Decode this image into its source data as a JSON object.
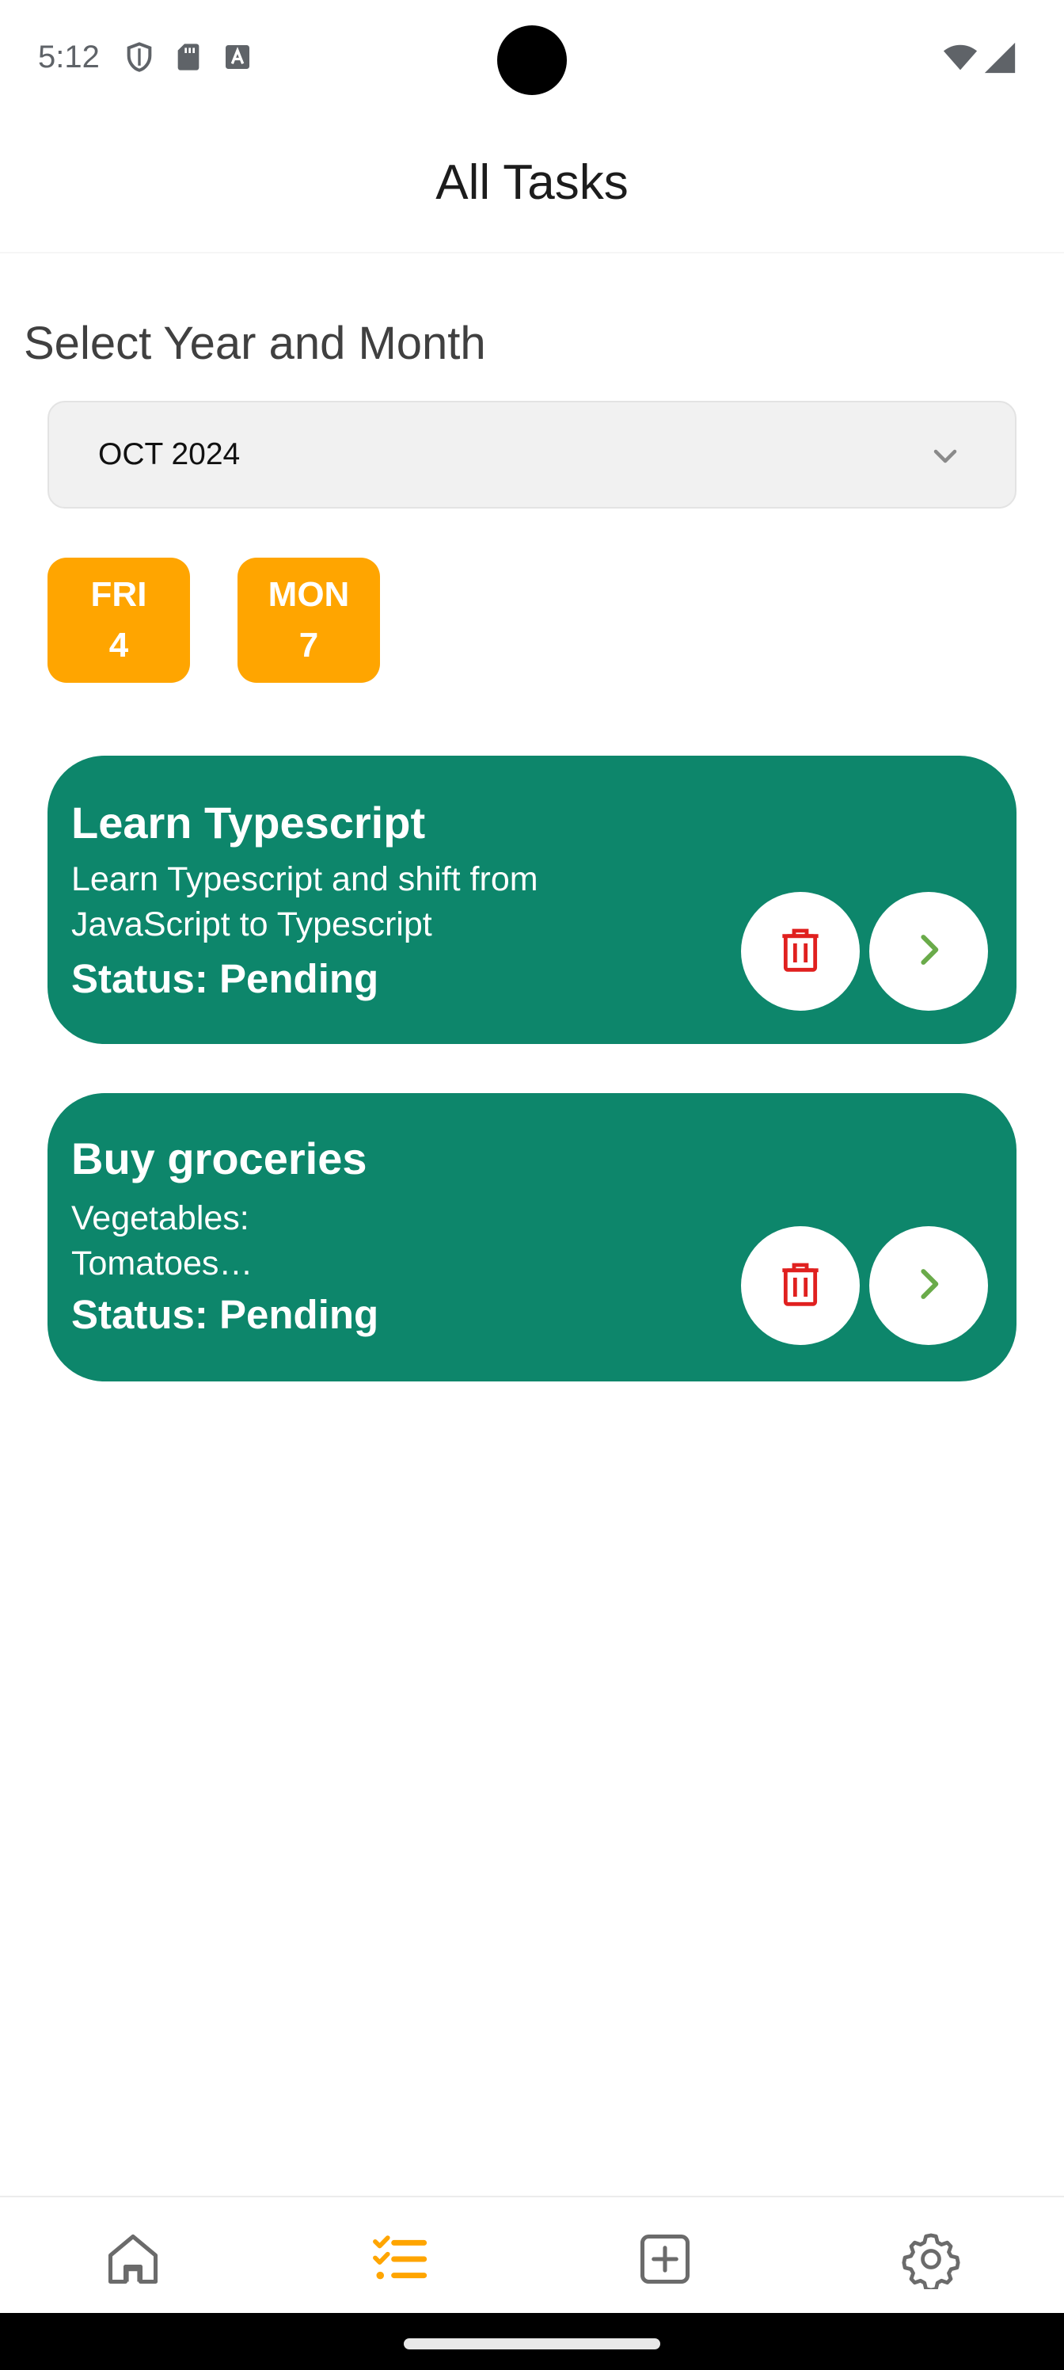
{
  "status_bar": {
    "time": "5:12",
    "left_icons": [
      "shield-icon",
      "sd-card-icon",
      "text-a-icon"
    ],
    "right_icons": [
      "wifi-icon",
      "cell-signal-icon"
    ]
  },
  "header": {
    "title": "All Tasks"
  },
  "selector": {
    "label": "Select Year and Month",
    "selected_value": "OCT 2024"
  },
  "days": [
    {
      "weekday": "FRI",
      "day": "4"
    },
    {
      "weekday": "MON",
      "day": "7"
    }
  ],
  "tasks": [
    {
      "title": "Learn Typescript",
      "description": "Learn Typescript and shift from JavaScript to Typescript",
      "status": "Status: Pending"
    },
    {
      "title": "Buy groceries",
      "description_lines": [
        "Vegetables:",
        "Tomatoes…"
      ],
      "status": "Status: Pending"
    }
  ],
  "bottom_nav": {
    "items": [
      {
        "icon": "home-icon",
        "active": false
      },
      {
        "icon": "tasks-list-icon",
        "active": true
      },
      {
        "icon": "add-square-icon",
        "active": false
      },
      {
        "icon": "settings-gear-icon",
        "active": false
      }
    ]
  },
  "colors": {
    "accent": "#FFA500",
    "card": "#0D866B",
    "delete": "#E0201F",
    "open_chevron": "#6AAB4A",
    "nav_inactive": "#6B6B6B"
  }
}
